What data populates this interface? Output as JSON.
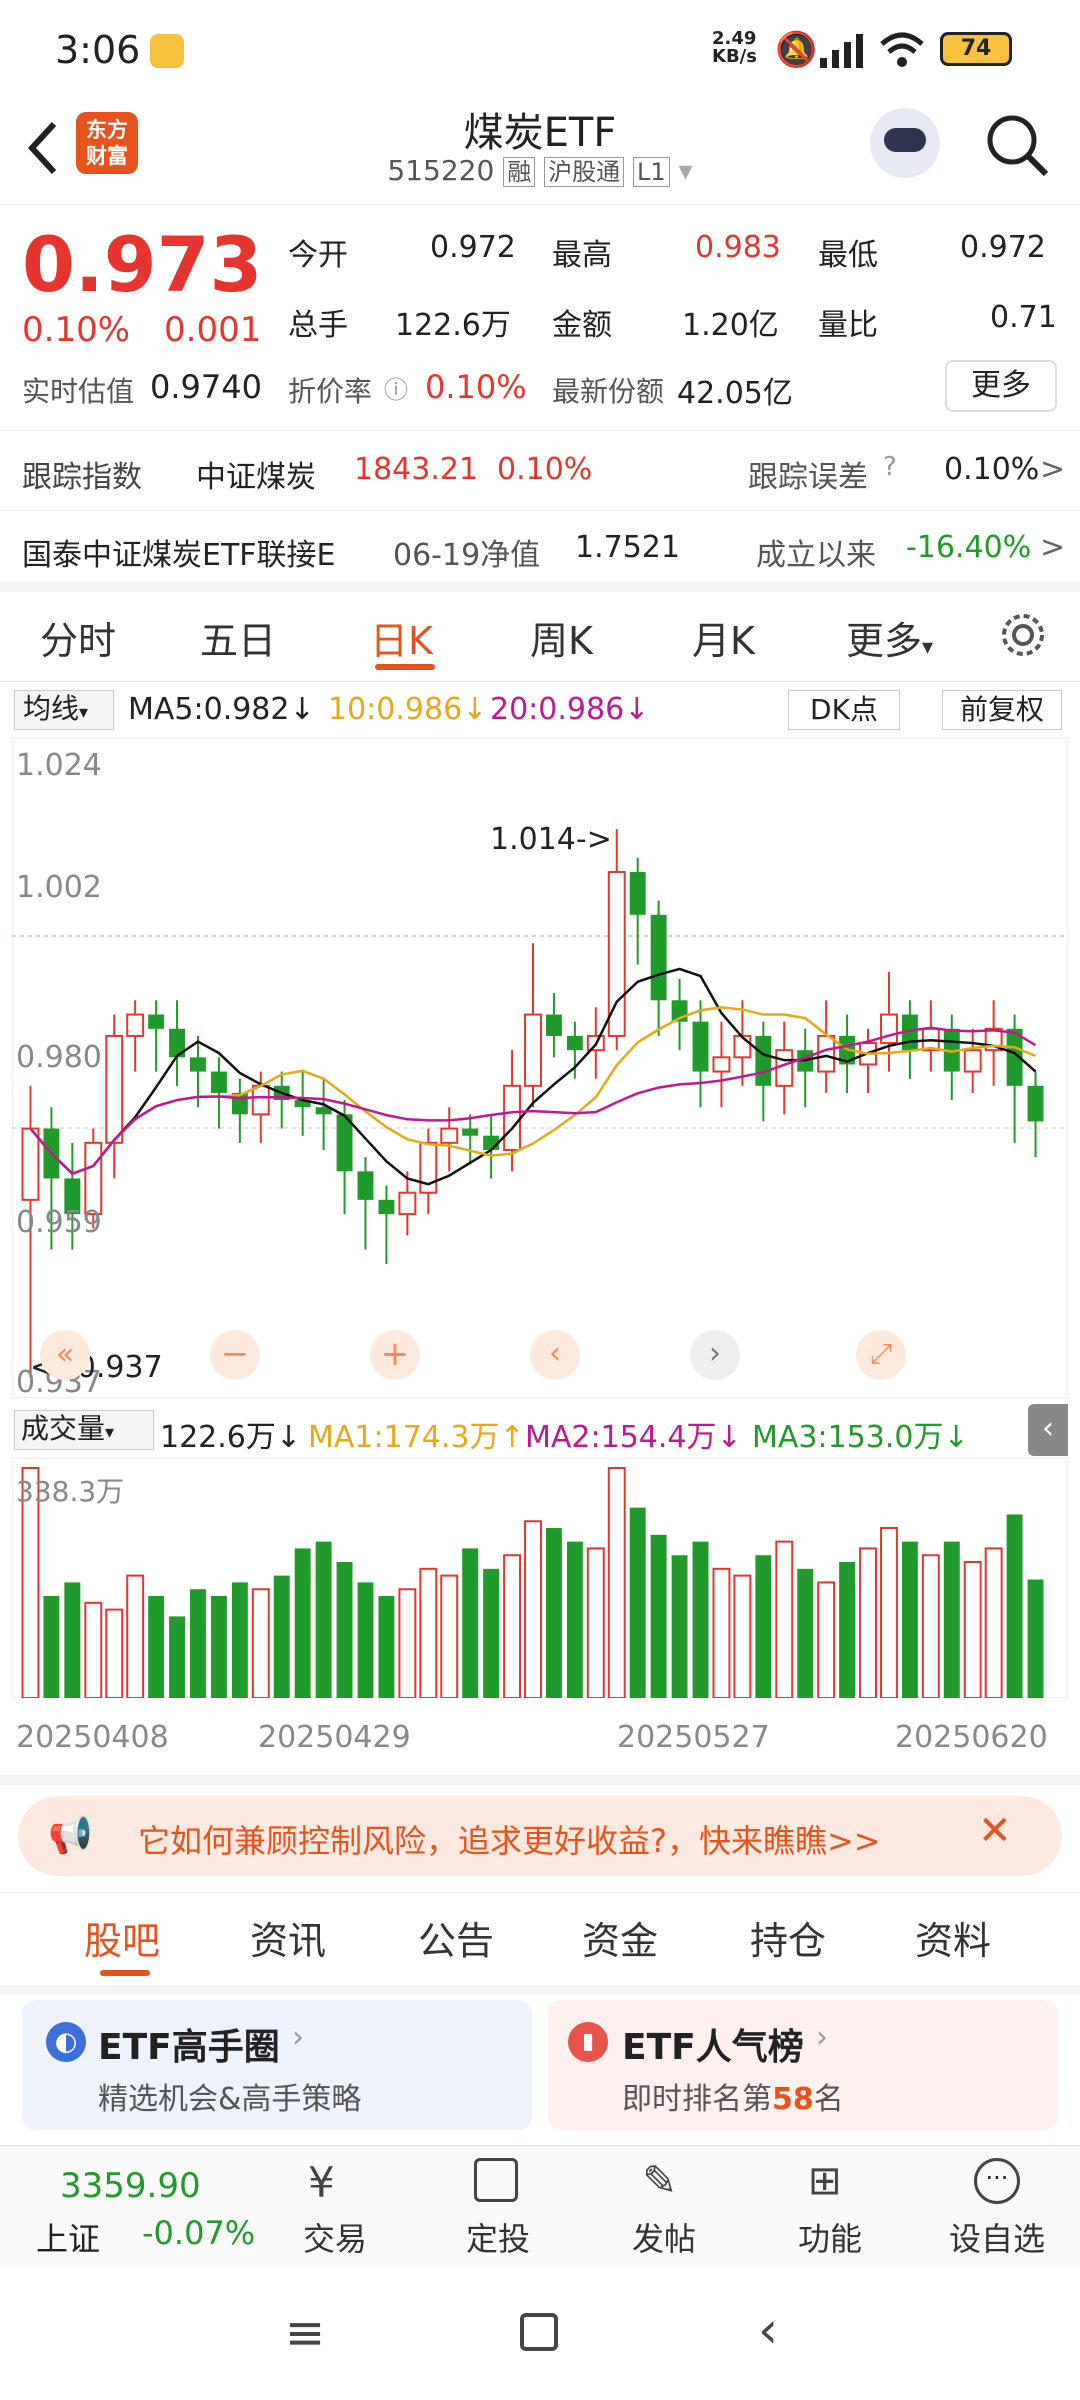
{
  "status": {
    "time": "3:06",
    "net_speed": "2.49",
    "net_unit": "KB/s",
    "battery": "74"
  },
  "header": {
    "logo_line1": "东方",
    "logo_line2": "财富",
    "title": "煤炭ETF",
    "code": "515220",
    "tag_margin": "融",
    "tag_connect": "沪股通",
    "tag_level": "L1"
  },
  "quote": {
    "price": "0.973",
    "change_pct": "0.10%",
    "change": "0.001",
    "open_label": "今开",
    "open": "0.972",
    "high_label": "最高",
    "high": "0.983",
    "low_label": "最低",
    "low": "0.972",
    "vol_label": "总手",
    "vol": "122.6万",
    "amt_label": "金额",
    "amt": "1.20亿",
    "ratio_label": "量比",
    "ratio": "0.71",
    "iopv_label": "实时估值",
    "iopv": "0.9740",
    "discount_label": "折价率",
    "discount": "0.10%",
    "shares_label": "最新份额",
    "shares": "42.05亿",
    "more": "更多"
  },
  "track": {
    "label": "跟踪指数",
    "index_name": "中证煤炭",
    "index_value": "1843.21",
    "index_pct": "0.10%",
    "err_label": "跟踪误差",
    "err_value": "0.10%"
  },
  "fund": {
    "name": "国泰中证煤炭ETF联接E",
    "nav_label": "06-19净值",
    "nav": "1.7521",
    "since_label": "成立以来",
    "since": "-16.40%"
  },
  "tabs": [
    "分时",
    "五日",
    "日K",
    "周K",
    "月K",
    "更多"
  ],
  "ma_bar": {
    "type": "均线",
    "ma5": "MA5:0.982",
    "ma10": "10:0.986",
    "ma20": "20:0.986",
    "dk": "DK点",
    "adjust": "前复权"
  },
  "kline": {
    "y_labels": [
      "1.024",
      "1.002",
      "0.980",
      "0.959",
      "0.937"
    ],
    "high_note": "1.014->",
    "low_note": "<--0.937"
  },
  "vol_bar": {
    "label": "成交量",
    "value": "122.6万",
    "ma1": "MA1:174.3万",
    "ma2": "MA2:154.4万",
    "ma3": "MA3:153.0万",
    "max": "338.3万"
  },
  "dates": [
    "20250408",
    "20250429",
    "20250527",
    "20250620"
  ],
  "promo": {
    "text": "它如何兼顾控制风险，追求更好收益?，快来瞧瞧>>"
  },
  "bottom_tabs": [
    "股吧",
    "资讯",
    "公告",
    "资金",
    "持仓",
    "资料"
  ],
  "cards": {
    "left_title": "ETF高手圈",
    "left_sub": "精选机会&高手策略",
    "right_title": "ETF人气榜",
    "right_sub_pre": "即时排名第",
    "right_rank": "58",
    "right_sub_post": "名"
  },
  "navbar": {
    "index_value": "3359.90",
    "index_name": "上证",
    "index_pct": "-0.07%",
    "items": [
      "交易",
      "定投",
      "发帖",
      "功能",
      "设自选"
    ]
  },
  "colors": {
    "up": "#e8342f",
    "down": "#1f9a2b",
    "accent": "#e8521c"
  },
  "chart_data": {
    "type": "candlestick",
    "ylim": [
      0.937,
      1.024
    ],
    "high": 1.014,
    "low": 0.937,
    "candles": [
      [
        0.962,
        0.972,
        0.937,
        0.978
      ],
      [
        0.972,
        0.965,
        0.955,
        0.975
      ],
      [
        0.965,
        0.96,
        0.955,
        0.97
      ],
      [
        0.96,
        0.97,
        0.958,
        0.972
      ],
      [
        0.97,
        0.985,
        0.965,
        0.988
      ],
      [
        0.985,
        0.988,
        0.98,
        0.99
      ],
      [
        0.988,
        0.986,
        0.98,
        0.99
      ],
      [
        0.986,
        0.982,
        0.978,
        0.99
      ],
      [
        0.982,
        0.98,
        0.975,
        0.985
      ],
      [
        0.98,
        0.977,
        0.972,
        0.982
      ],
      [
        0.977,
        0.974,
        0.97,
        0.979
      ],
      [
        0.974,
        0.978,
        0.97,
        0.98
      ],
      [
        0.978,
        0.976,
        0.972,
        0.98
      ],
      [
        0.976,
        0.975,
        0.971,
        0.98
      ],
      [
        0.975,
        0.974,
        0.969,
        0.979
      ],
      [
        0.974,
        0.966,
        0.96,
        0.976
      ],
      [
        0.966,
        0.962,
        0.955,
        0.968
      ],
      [
        0.962,
        0.96,
        0.953,
        0.964
      ],
      [
        0.96,
        0.963,
        0.957,
        0.966
      ],
      [
        0.963,
        0.97,
        0.96,
        0.972
      ],
      [
        0.97,
        0.972,
        0.966,
        0.975
      ],
      [
        0.972,
        0.971,
        0.967,
        0.974
      ],
      [
        0.971,
        0.969,
        0.965,
        0.974
      ],
      [
        0.969,
        0.978,
        0.966,
        0.983
      ],
      [
        0.978,
        0.988,
        0.975,
        0.998
      ],
      [
        0.988,
        0.985,
        0.982,
        0.991
      ],
      [
        0.985,
        0.983,
        0.979,
        0.987
      ],
      [
        0.983,
        0.985,
        0.979,
        0.989
      ],
      [
        0.985,
        1.008,
        0.983,
        1.014
      ],
      [
        1.008,
        1.002,
        0.995,
        1.01
      ],
      [
        1.002,
        0.99,
        0.985,
        1.004
      ],
      [
        0.99,
        0.987,
        0.983,
        0.993
      ],
      [
        0.987,
        0.98,
        0.975,
        0.99
      ],
      [
        0.98,
        0.982,
        0.975,
        0.987
      ],
      [
        0.982,
        0.985,
        0.978,
        0.99
      ],
      [
        0.985,
        0.978,
        0.973,
        0.987
      ],
      [
        0.978,
        0.983,
        0.974,
        0.987
      ],
      [
        0.983,
        0.98,
        0.975,
        0.986
      ],
      [
        0.98,
        0.985,
        0.977,
        0.99
      ],
      [
        0.985,
        0.981,
        0.977,
        0.988
      ],
      [
        0.981,
        0.984,
        0.977,
        0.986
      ],
      [
        0.984,
        0.988,
        0.98,
        0.994
      ],
      [
        0.988,
        0.983,
        0.979,
        0.99
      ],
      [
        0.983,
        0.986,
        0.98,
        0.99
      ],
      [
        0.986,
        0.98,
        0.976,
        0.988
      ],
      [
        0.98,
        0.983,
        0.977,
        0.986
      ],
      [
        0.983,
        0.986,
        0.978,
        0.99
      ],
      [
        0.986,
        0.978,
        0.97,
        0.988
      ],
      [
        0.978,
        0.973,
        0.968,
        0.98
      ]
    ],
    "volume": [
      338.3,
      150,
      170,
      140,
      130,
      180,
      150,
      120,
      160,
      150,
      170,
      160,
      180,
      220,
      230,
      200,
      170,
      150,
      160,
      190,
      180,
      220,
      190,
      210,
      260,
      250,
      230,
      220,
      338.3,
      280,
      240,
      210,
      230,
      190,
      180,
      210,
      230,
      190,
      170,
      200,
      220,
      250,
      230,
      210,
      230,
      200,
      220,
      270,
      174.3
    ]
  }
}
